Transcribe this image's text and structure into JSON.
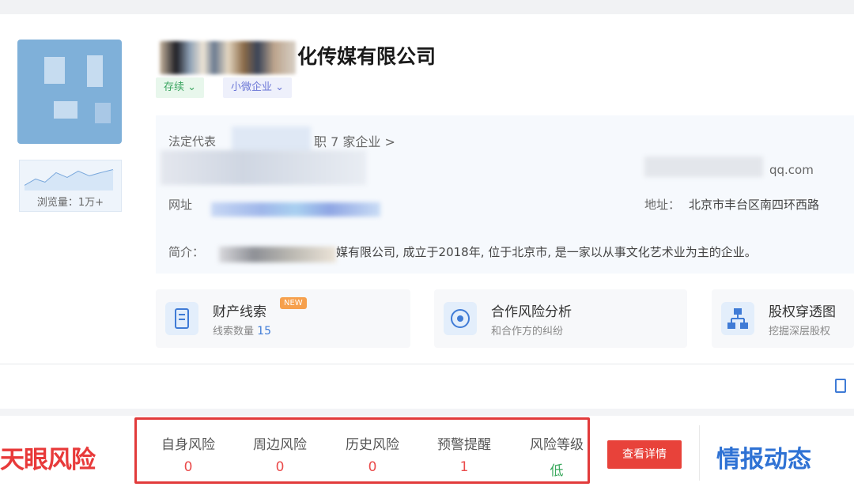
{
  "company": {
    "name_visible": "化传媒有限公司",
    "tags": [
      "存续",
      "小微企业"
    ]
  },
  "views": {
    "label": "浏览量：1万+"
  },
  "info": {
    "legal_rep_label": "法定代表",
    "legal_rep_link": "职 7 家企业 >",
    "email_suffix": "qq.com",
    "website_label": "网址",
    "address_label": "地址：",
    "address_value": "北京市丰台区南四环西路",
    "intro_label": "简介：",
    "intro_text": "媒有限公司, 成立于2018年, 位于北京市, 是一家以从事文化艺术业为主的企业。"
  },
  "features": [
    {
      "title": "财产线索",
      "badge": "NEW",
      "sub_label": "线索数量",
      "sub_value": "15",
      "icon": "clue-icon"
    },
    {
      "title": "合作风险分析",
      "sub_label": "和合作方的纠纷",
      "icon": "partner-risk-icon"
    },
    {
      "title": "股权穿透图",
      "sub_label": "挖掘深层股权",
      "icon": "equity-graph-icon"
    }
  ],
  "risk": {
    "brand": "天眼风险",
    "items": [
      {
        "label": "自身风险",
        "value": "0"
      },
      {
        "label": "周边风险",
        "value": "0"
      },
      {
        "label": "历史风险",
        "value": "0"
      },
      {
        "label": "预警提醒",
        "value": "1"
      },
      {
        "label": "风险等级",
        "value": "低"
      }
    ],
    "detail_button": "查看详情"
  },
  "intel": {
    "title": "情报动态"
  },
  "colors": {
    "accent_red": "#e83a3a",
    "accent_blue": "#2f72d4",
    "low_green": "#3aa85d",
    "link_orange": "#f07a28"
  }
}
